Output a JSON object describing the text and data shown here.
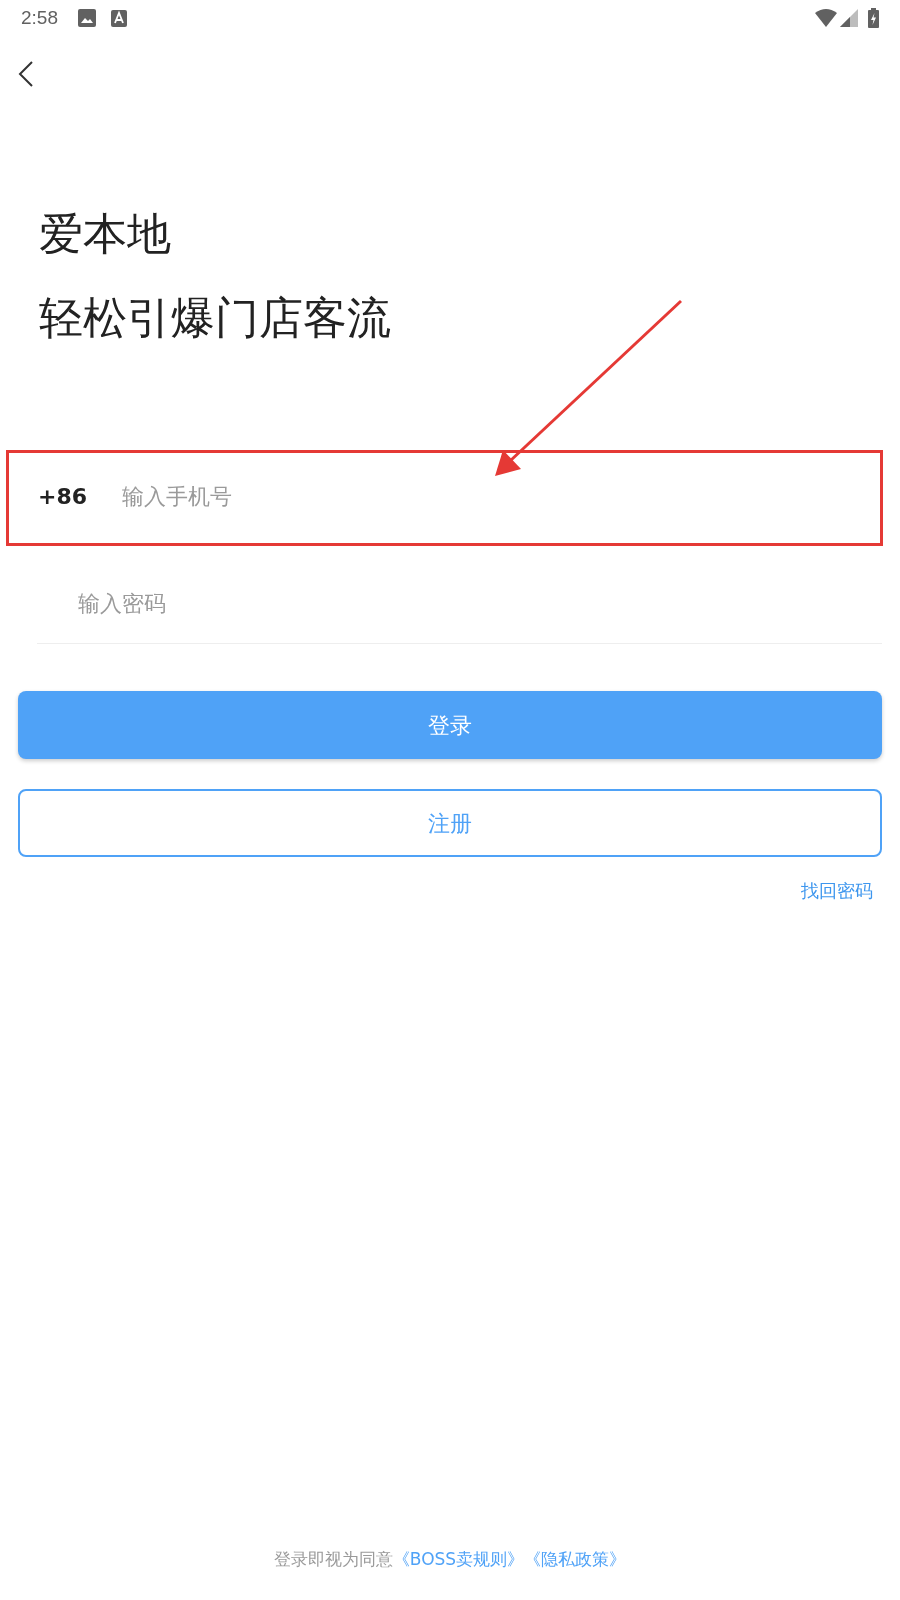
{
  "status_bar": {
    "time": "2:58"
  },
  "headline": [
    "爱本地",
    "轻松引爆门店客流"
  ],
  "phone": {
    "country_code": "+86",
    "placeholder": "输入手机号"
  },
  "password": {
    "placeholder": "输入密码"
  },
  "login_button": "登录",
  "register_button": "注册",
  "forgot_link": "找回密码",
  "agreement": {
    "text": "登录即视为同意",
    "links": [
      "《BOSS卖规则》",
      "《隐私政策》"
    ]
  }
}
